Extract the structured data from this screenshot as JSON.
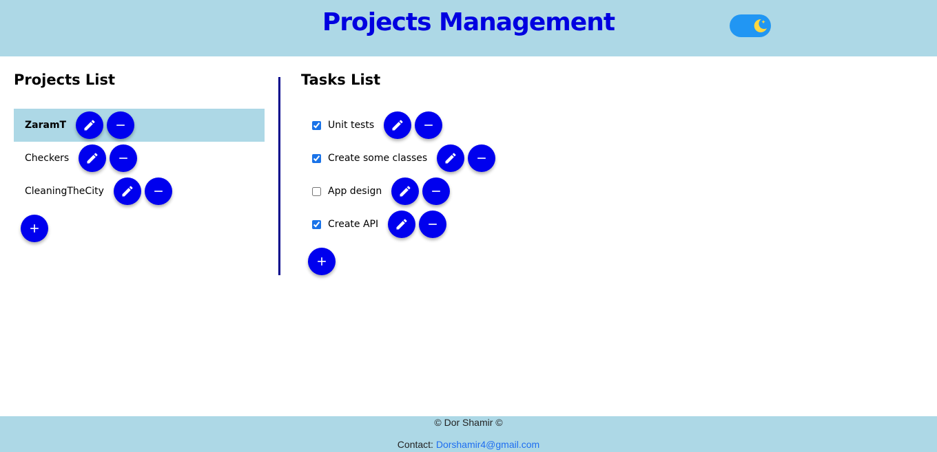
{
  "header": {
    "title": "Projects Management",
    "theme_toggle": {
      "mode": "dark",
      "icon": "moon-icon",
      "on": true
    }
  },
  "projects": {
    "title": "Projects List",
    "items": [
      {
        "name": "ZaramT",
        "selected": true
      },
      {
        "name": "Checkers",
        "selected": false
      },
      {
        "name": "CleaningTheCity",
        "selected": false
      }
    ]
  },
  "tasks": {
    "title": "Tasks List",
    "items": [
      {
        "label": "Unit tests",
        "done": true
      },
      {
        "label": "Create some classes",
        "done": true
      },
      {
        "label": "App design",
        "done": false
      },
      {
        "label": "Create API",
        "done": true
      }
    ]
  },
  "footer": {
    "copyright": "© Dor Shamir ©",
    "contact_label": "Contact: ",
    "contact_email": "Dorshamir4@gmail.com"
  },
  "colors": {
    "header_bg": "#add8e6",
    "title": "#0000e0",
    "button": "#0000ee",
    "divider": "#00008b",
    "toggle": "#2196f3",
    "moon": "#ffd740"
  }
}
